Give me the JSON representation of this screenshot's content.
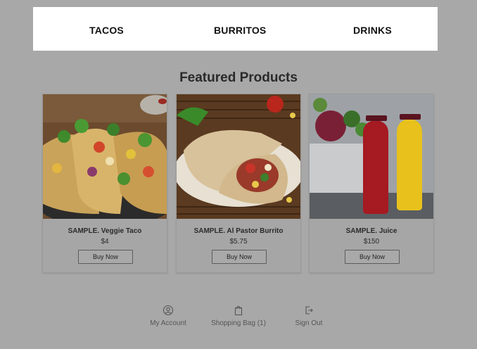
{
  "nav": {
    "items": [
      {
        "label": "TACOS"
      },
      {
        "label": "BURRITOS"
      },
      {
        "label": "DRINKS"
      }
    ]
  },
  "featured": {
    "title": "Featured Products",
    "products": [
      {
        "name": "SAMPLE. Veggie Taco",
        "price": "$4",
        "button": "Buy Now",
        "image_icon": "tacos-photo"
      },
      {
        "name": "SAMPLE. Al Pastor Burrito",
        "price": "$5.75",
        "button": "Buy Now",
        "image_icon": "burrito-photo"
      },
      {
        "name": "SAMPLE. Juice",
        "price": "$150",
        "button": "Buy Now",
        "image_icon": "juice-bottles-photo"
      }
    ]
  },
  "footer": {
    "items": [
      {
        "label": "My Account",
        "icon": "user-circle-icon"
      },
      {
        "label": "Shopping Bag (1)",
        "icon": "shopping-bag-icon"
      },
      {
        "label": "Sign Out",
        "icon": "sign-out-icon"
      }
    ]
  },
  "colors": {
    "overlay_background": "#a8a8a8",
    "nav_background": "#ffffff"
  }
}
